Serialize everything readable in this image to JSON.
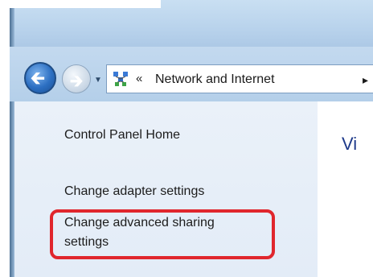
{
  "address_bar": {
    "icon": "network-and-internet-icon",
    "chevrons": "«",
    "path": "Network and Internet",
    "separator": "▸"
  },
  "nav": {
    "back": "back-arrow-icon",
    "forward": "forward-arrow-icon",
    "history": "dropdown-arrow-icon"
  },
  "sidebar": {
    "items": [
      {
        "label": "Control Panel Home"
      },
      {
        "label": "Change adapter settings"
      },
      {
        "label_line1": "Change advanced sharing",
        "label_line2": "settings"
      }
    ]
  },
  "main": {
    "title_fragment": "Vi"
  },
  "colors": {
    "highlight": "#e0262d",
    "title_blue": "#1e3a8a",
    "pane_bg": "#e3ecf7"
  }
}
